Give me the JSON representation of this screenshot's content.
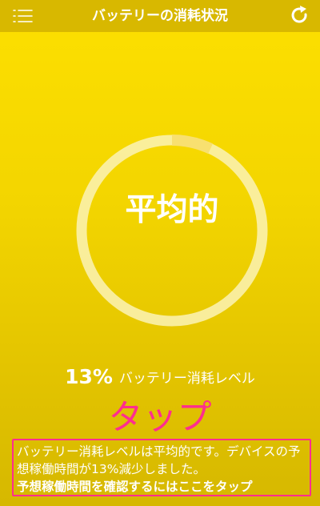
{
  "header": {
    "title": "バッテリーの消耗状況",
    "menu_icon": "menu-icon",
    "refresh_icon": "refresh-icon"
  },
  "gauge": {
    "status_label": "平均的",
    "fill_fraction": 0.07
  },
  "level": {
    "percent": "13%",
    "label": "バッテリー消耗レベル"
  },
  "tap_label": "タップ",
  "info": {
    "message": "バッテリー消耗レベルは平均的です。デバイスの予想稼働時間が13%減少しました。",
    "link": "予想稼働時間を確認するにはここをタップ"
  },
  "colors": {
    "accent": "#ff2d8f",
    "background": "#f3d500",
    "ring": "#fbf1b0"
  }
}
